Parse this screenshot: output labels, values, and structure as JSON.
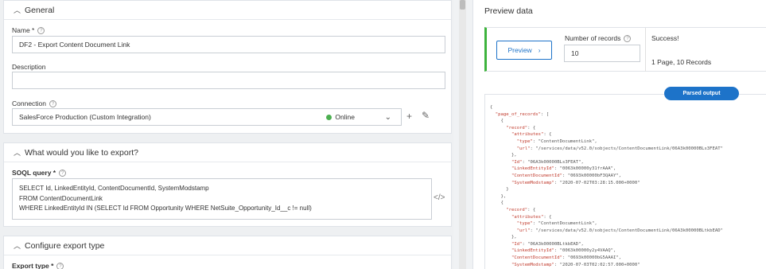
{
  "general": {
    "section_title": "General",
    "name_label": "Name *",
    "name_value": "DF2 - Export Content Document Link",
    "description_label": "Description",
    "description_value": "",
    "connection_label": "Connection",
    "connection_value": "SalesForce Production (Custom Integration)",
    "connection_status": "Online",
    "status_color": "#4caf50"
  },
  "export": {
    "section_title": "What would you like to export?",
    "soql_label": "SOQL query *",
    "soql_lines": [
      "SELECT Id, LinkedEntityId, ContentDocumentId, SystemModstamp",
      "FROM ContentDocumentLink",
      "WHERE LinkedEntityId IN (SELECT Id FROM Opportunity WHERE NetSuite_Opportunity_Id__c != null)"
    ]
  },
  "configure": {
    "section_title": "Configure export type",
    "export_type_label": "Export type *"
  },
  "preview": {
    "title": "Preview data",
    "button_label": "Preview",
    "records_label": "Number of records",
    "records_value": "10",
    "status": "Success!",
    "pages_summary": "1 Page, 10 Records",
    "parsed_output_label": "Parsed output",
    "accent_color": "#1d73c9",
    "success_color": "#3db33d"
  },
  "output_json": [
    "{",
    "  \"page_of_records\": [",
    "    {",
    "      \"record\": {",
    "        \"attributes\": {",
    "          \"type\": \"ContentDocumentLink\",",
    "          \"url\": \"/services/data/v52.0/sobjects/ContentDocumentLink/06A3k00000BLs3FEAT\"",
    "        },",
    "        \"Id\": \"06A3k00000BLs3FEAT\",",
    "        \"LinkedEntityId\": \"0063k00000y31frAAA\",",
    "        \"ContentDocumentId\": \"0693k00000bF3QAAY\",",
    "        \"SystemModstamp\": \"2020-07-02T03:28:15.000+0000\"",
    "      }",
    "    },",
    "    {",
    "      \"record\": {",
    "        \"attributes\": {",
    "          \"type\": \"ContentDocumentLink\",",
    "          \"url\": \"/services/data/v52.0/sobjects/ContentDocumentLink/06A3k00000BLtkbEAD\"",
    "        },",
    "        \"Id\": \"06A3k00000BLtkbEAD\",",
    "        \"LinkedEntityId\": \"0063k00000y2y4VAAQ\",",
    "        \"ContentDocumentId\": \"0693k00000bG5AAAI\",",
    "        \"SystemModstamp\": \"2020-07-03T02:02:57.000+0000\"",
    "      }"
  ]
}
